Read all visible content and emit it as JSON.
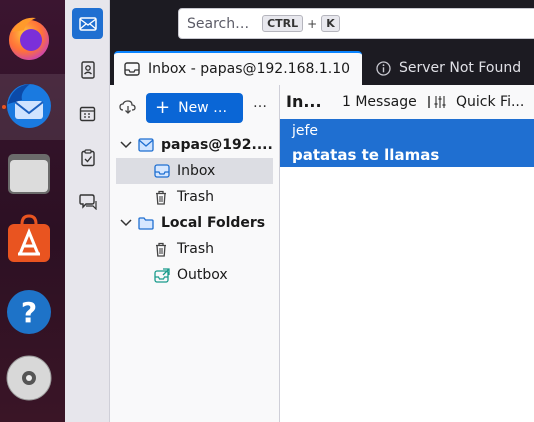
{
  "dock": {
    "apps": [
      {
        "icon": "firefox-icon"
      },
      {
        "icon": "thunderbird-icon",
        "active": true
      },
      {
        "icon": "files-icon"
      },
      {
        "icon": "software-center-icon"
      },
      {
        "icon": "help-icon"
      },
      {
        "icon": "disc-icon"
      }
    ],
    "accent": "#e95420"
  },
  "spaces": {
    "items": [
      {
        "icon": "mail-icon",
        "active": true
      },
      {
        "icon": "address-book-icon"
      },
      {
        "icon": "calendar-icon"
      },
      {
        "icon": "tasks-icon"
      },
      {
        "icon": "chat-icon"
      }
    ]
  },
  "search": {
    "placeholder": "Search…",
    "shortcut_key1": "CTRL",
    "shortcut_plus": "+",
    "shortcut_key2": "K"
  },
  "tabs": [
    {
      "label": "Inbox - papas@192.168.1.10",
      "icon": "inbox-icon",
      "active": true
    },
    {
      "label": "Server Not Found",
      "icon": "info-icon"
    }
  ],
  "folder_pane": {
    "new_button": "New …",
    "new_button_icon": "+",
    "more": "…",
    "tree": [
      {
        "label": "papas@192....",
        "icon": "mail-account-icon",
        "expanded": true,
        "bold": true
      },
      {
        "label": "Inbox",
        "icon": "inbox-icon",
        "selected": true
      },
      {
        "label": "Trash",
        "icon": "trash-icon"
      },
      {
        "label": "Local Folders",
        "icon": "folder-icon",
        "expanded": true,
        "bold": true
      },
      {
        "label": "Trash",
        "icon": "trash-icon"
      },
      {
        "label": "Outbox",
        "icon": "outbox-icon"
      }
    ]
  },
  "message_list": {
    "title": "In...",
    "count": "1 Message",
    "quick_filter": "Quick Fi...",
    "messages": [
      {
        "from": "jefe",
        "subject": "patatas te llamas",
        "selected": true
      }
    ]
  },
  "colors": {
    "accent": "#1f6fd1",
    "selection": "#1f6fd1",
    "dark_bar": "#1c1b22"
  }
}
